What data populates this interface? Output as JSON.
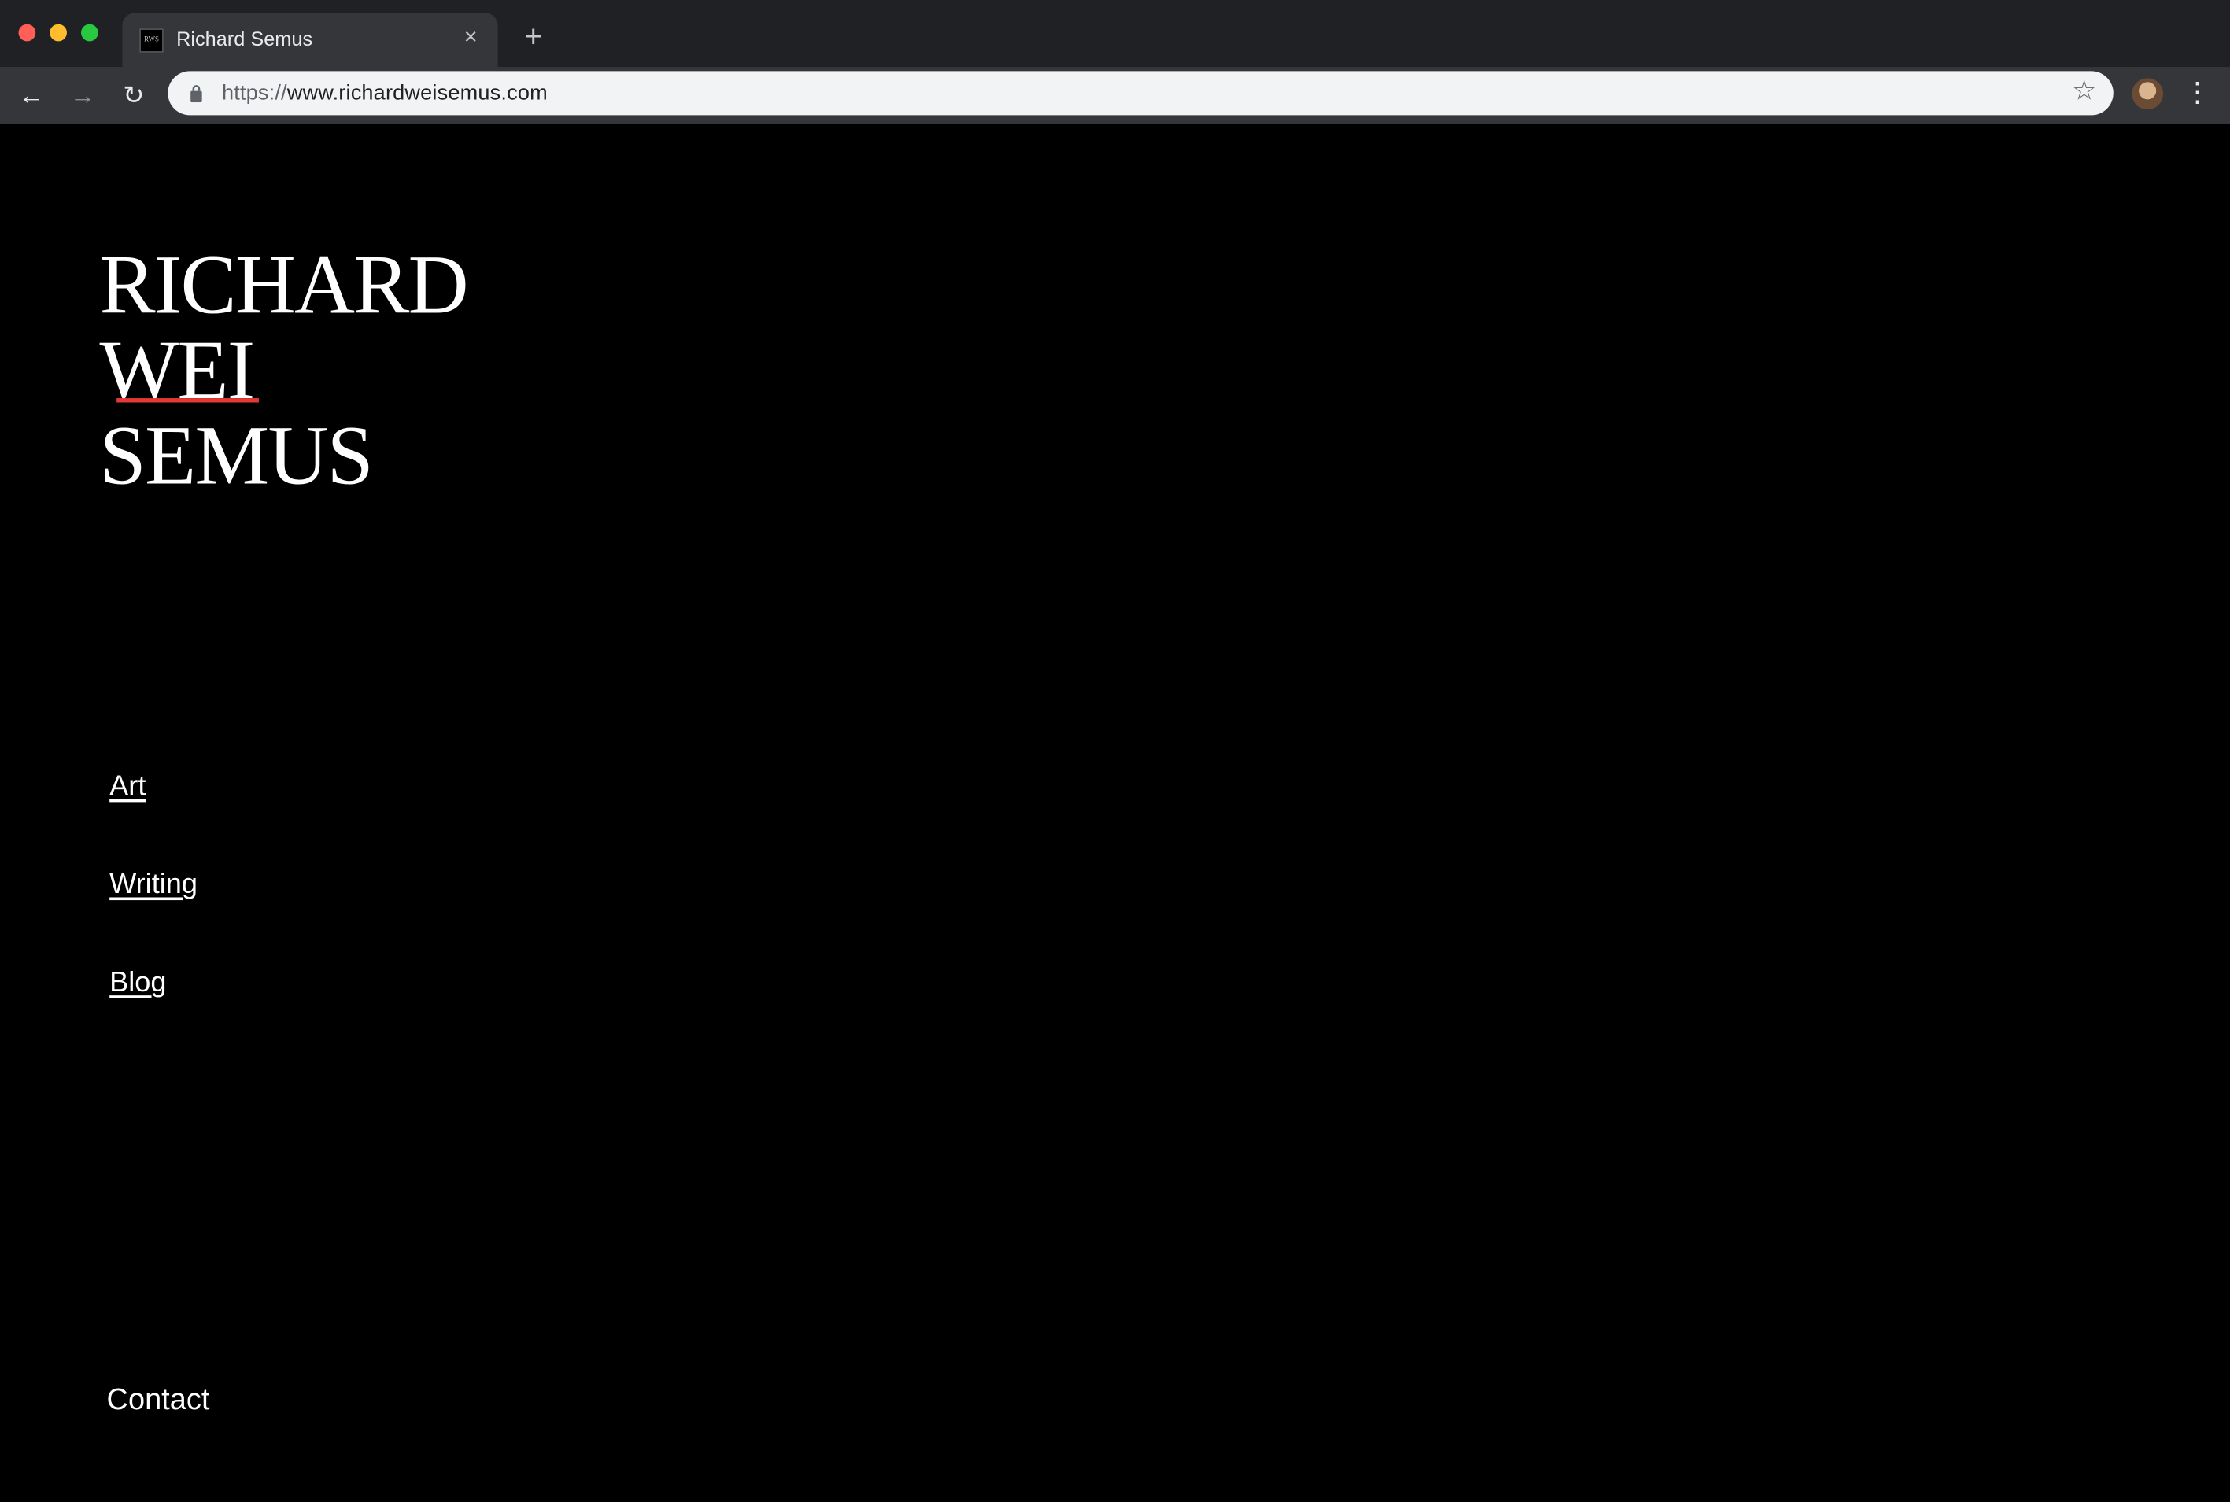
{
  "browser": {
    "tab_title": "Richard Semus",
    "favicon_text": "RWS",
    "url_scheme": "https://",
    "url_rest": "www.richardweisemus.com"
  },
  "page": {
    "logo": [
      "RICHARD",
      "WEI",
      "SEMUS"
    ],
    "nav": [
      "Art",
      "Writing",
      "Blog"
    ],
    "contact": "Contact",
    "colors": {
      "background": "#000000",
      "text": "#ffffff",
      "accent_underline": "#e53935"
    }
  }
}
